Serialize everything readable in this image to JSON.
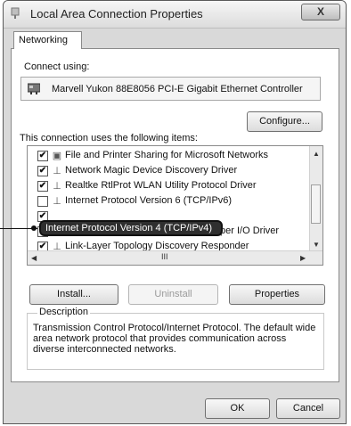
{
  "window": {
    "title": "Local Area Connection Properties",
    "close_label": "X"
  },
  "tabs": [
    {
      "label": "Networking",
      "active": true
    }
  ],
  "connect_using": {
    "label": "Connect using:",
    "adapter": "Marvell Yukon 88E8056 PCI-E Gigabit Ethernet Controller",
    "adapter_icon": "network-adapter-icon"
  },
  "buttons": {
    "configure": "Configure...",
    "install": "Install...",
    "uninstall": "Uninstall",
    "properties": "Properties",
    "ok": "OK",
    "cancel": "Cancel"
  },
  "items_label": "This connection uses the following items:",
  "items": [
    {
      "label": "File and Printer Sharing for Microsoft Networks",
      "checked": true,
      "icon": "printer-icon"
    },
    {
      "label": "Network Magic Device Discovery Driver",
      "checked": true,
      "icon": "protocol-icon"
    },
    {
      "label": "Realtke RtlProt WLAN Utility Protocol Driver",
      "checked": true,
      "icon": "protocol-icon"
    },
    {
      "label": "Internet Protocol Version 6 (TCP/IPv6)",
      "checked": false,
      "icon": "protocol-icon"
    },
    {
      "label": "Internet Protocol Version 4 (TCP/IPv4)",
      "checked": true,
      "icon": "protocol-icon",
      "selected": true
    },
    {
      "label": "Link-Layer Topology Discovery Mapper I/O Driver",
      "checked": true,
      "icon": "protocol-icon"
    },
    {
      "label": "Link-Layer Topology Discovery Responder",
      "checked": true,
      "icon": "protocol-icon"
    }
  ],
  "description": {
    "legend": "Description",
    "text": "Transmission Control Protocol/Internet Protocol. The default wide area network protocol that provides communication across diverse interconnected networks."
  },
  "scrollbar": {
    "thumb_label": "III"
  },
  "colors": {
    "selection_bg": "#2f2f2f",
    "window_bg": "#d9d9d9"
  }
}
